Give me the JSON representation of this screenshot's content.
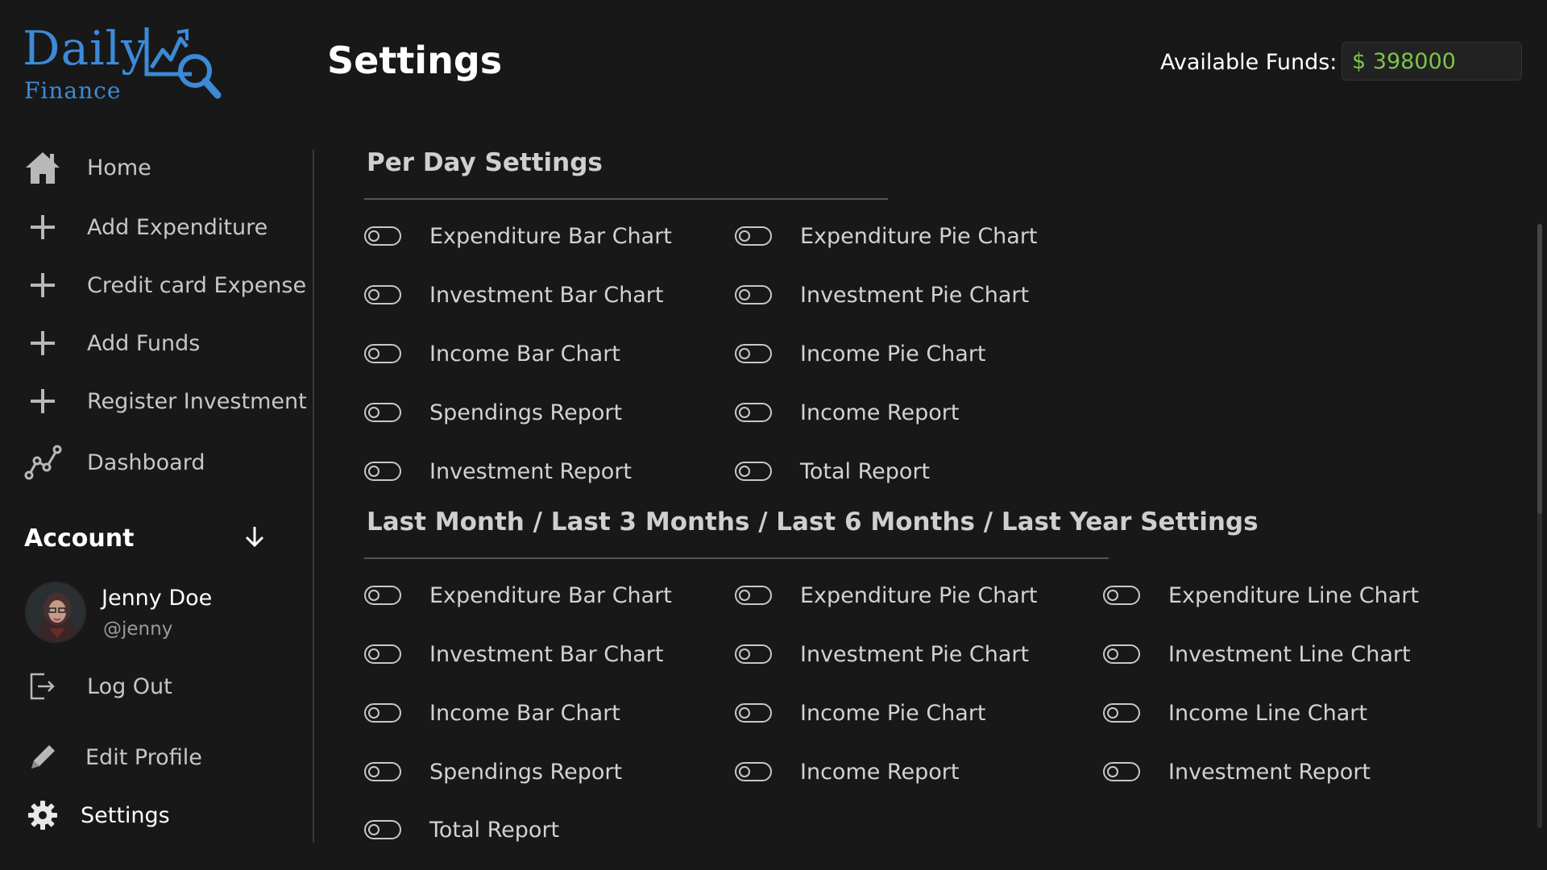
{
  "logo": {
    "line1": "Daily",
    "line2": "Finance"
  },
  "header": {
    "title": "Settings",
    "funds_label": "Available Funds:",
    "funds_value": "$ 398000"
  },
  "sidebar": {
    "items": [
      {
        "label": "Home",
        "icon": "home-icon"
      },
      {
        "label": "Add Expenditure",
        "icon": "plus-icon"
      },
      {
        "label": "Credit card Expense",
        "icon": "plus-icon"
      },
      {
        "label": "Add Funds",
        "icon": "plus-icon"
      },
      {
        "label": "Register Investment",
        "icon": "plus-icon"
      },
      {
        "label": "Dashboard",
        "icon": "chart-line-icon"
      }
    ],
    "account": {
      "title": "Account",
      "user_name": "Jenny Doe",
      "user_handle": "@jenny",
      "items": [
        {
          "label": "Log Out",
          "icon": "logout-icon"
        },
        {
          "label": "Edit Profile",
          "icon": "pencil-icon"
        },
        {
          "label": "Settings",
          "icon": "gear-icon"
        }
      ]
    }
  },
  "per_day": {
    "title": "Per Day Settings",
    "col1": [
      "Expenditure Bar Chart",
      "Investment Bar Chart",
      "Income Bar Chart",
      "Spendings Report",
      "Investment Report"
    ],
    "col2": [
      "Expenditure Pie Chart",
      "Investment Pie Chart",
      "Income Pie Chart",
      "Income Report",
      "Total Report"
    ]
  },
  "periodic": {
    "title": "Last Month / Last 3 Months / Last 6 Months / Last Year Settings",
    "col1": [
      "Expenditure Bar Chart",
      "Investment Bar Chart",
      "Income Bar Chart",
      "Spendings Report",
      "Total Report"
    ],
    "col2": [
      "Expenditure Pie Chart",
      "Investment Pie Chart",
      "Income Pie Chart",
      "Income Report"
    ],
    "col3": [
      "Expenditure Line Chart",
      "Investment Line Chart",
      "Income Line Chart",
      "Investment Report"
    ]
  },
  "colors": {
    "background": "#181818",
    "brand": "#3c8ad8",
    "funds": "#7ec34a"
  }
}
